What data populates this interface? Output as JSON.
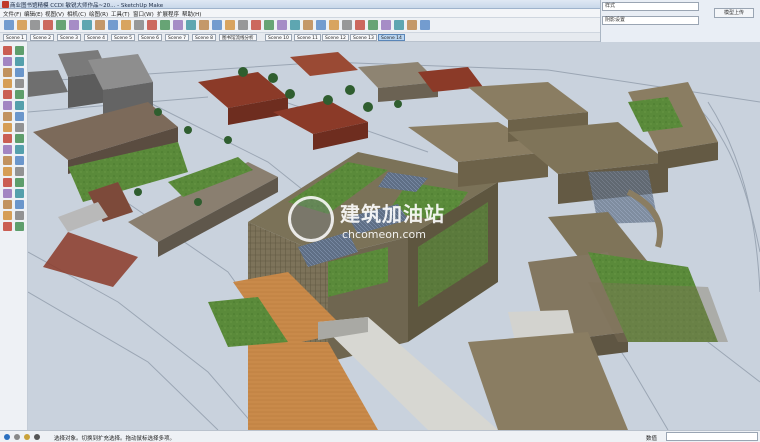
{
  "window": {
    "title": "商业图书馆精模 CCDI 敏锐大师作品~20...  - SketchUp Make"
  },
  "menu": [
    "文件(F)",
    "编辑(E)",
    "视图(V)",
    "相机(C)",
    "绘图(R)",
    "工具(T)",
    "窗口(W)",
    "扩展程序",
    "帮助(H)"
  ],
  "scenes": {
    "tabs": [
      "Scene 1",
      "Scene 2",
      "Scene 3",
      "Scene 4",
      "Scene 5",
      "Scene 6",
      "Scene 7",
      "Scene 8",
      "图书馆流线分析",
      "Scene 10",
      "Scene 11",
      "Scene 12",
      "Scene 13",
      "Scene 14"
    ],
    "active": "Scene 14"
  },
  "right_panel": {
    "style_label": "样式",
    "shadow_label": "阴影设置",
    "upload_button": "模型上传"
  },
  "status": {
    "text": "选择对象。切换到扩充选择。拖动鼠标选择多项。",
    "measure_label": "数值",
    "measure_value": ""
  },
  "watermark": {
    "title": "建筑加油站",
    "url": "chcomeon.com"
  },
  "colors": {
    "sky": "#d6dde6",
    "roof_green": "#5a8a3a",
    "brick_red": "#8b3a28",
    "concrete": "#8a7d62",
    "plaza_orange": "#c98a4a",
    "road_grey": "#b7c0cb",
    "selection_blue": "#b8d4f0"
  },
  "icons": {
    "toolbar": [
      "new-icon",
      "open-icon",
      "save-icon",
      "cut-icon",
      "copy-icon",
      "paste-icon",
      "erase-icon",
      "undo-icon",
      "redo-icon",
      "print-icon",
      "orbit-icon",
      "pan-icon",
      "zoom-icon",
      "zoom-extents-icon",
      "walk-icon",
      "look-icon",
      "position-camera-icon",
      "section-icon",
      "style-xray-icon",
      "style-wire-icon",
      "style-hidden-icon",
      "style-shaded-icon",
      "style-texture-icon",
      "style-mono-icon",
      "iso-view-icon",
      "top-view-icon",
      "front-view-icon",
      "right-view-icon",
      "back-view-icon",
      "left-view-icon",
      "warehouse-icon",
      "extension-icon",
      "layout-icon"
    ],
    "left_tools": [
      "select-icon",
      "component-icon",
      "paint-bucket-icon",
      "eraser-icon",
      "line-icon",
      "freehand-icon",
      "rectangle-icon",
      "rotated-rectangle-icon",
      "circle-icon",
      "polygon-icon",
      "arc-icon",
      "pie-icon",
      "move-icon",
      "push-pull-icon",
      "rotate-icon",
      "follow-me-icon",
      "scale-icon",
      "offset-icon",
      "tape-measure-icon",
      "dimension-icon",
      "protractor-icon",
      "text-icon",
      "axes-icon",
      "3d-text-icon",
      "orbit-icon",
      "pan-icon",
      "zoom-icon",
      "zoom-window-icon",
      "zoom-extents-icon",
      "previous-view-icon",
      "position-camera-icon",
      "look-around-icon",
      "walk-icon",
      "section-plane-icon"
    ]
  }
}
